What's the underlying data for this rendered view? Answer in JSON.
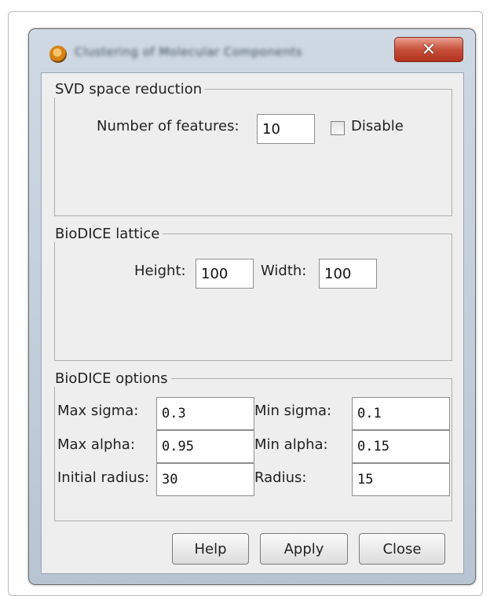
{
  "window": {
    "title": "Clustering of Molecular Components",
    "close_glyph": "✕"
  },
  "svd": {
    "legend": "SVD space reduction",
    "features_label": "Number of features:",
    "features_value": "10",
    "disable_label": "Disable",
    "disable_checked": false
  },
  "lattice": {
    "legend": "BioDICE lattice",
    "height_label": "Height:",
    "height_value": "100",
    "width_label": "Width:",
    "width_value": "100"
  },
  "options": {
    "legend": "BioDICE options",
    "max_sigma_label": "Max sigma:",
    "max_sigma_value": "0.3",
    "min_sigma_label": "Min sigma:",
    "min_sigma_value": "0.1",
    "max_alpha_label": "Max alpha:",
    "max_alpha_value": "0.95",
    "min_alpha_label": "Min alpha:",
    "min_alpha_value": "0.15",
    "initial_radius_label": "Initial radius:",
    "initial_radius_value": "30",
    "radius_label": "Radius:",
    "radius_value": "15"
  },
  "buttons": {
    "help": "Help",
    "apply": "Apply",
    "close": "Close"
  }
}
